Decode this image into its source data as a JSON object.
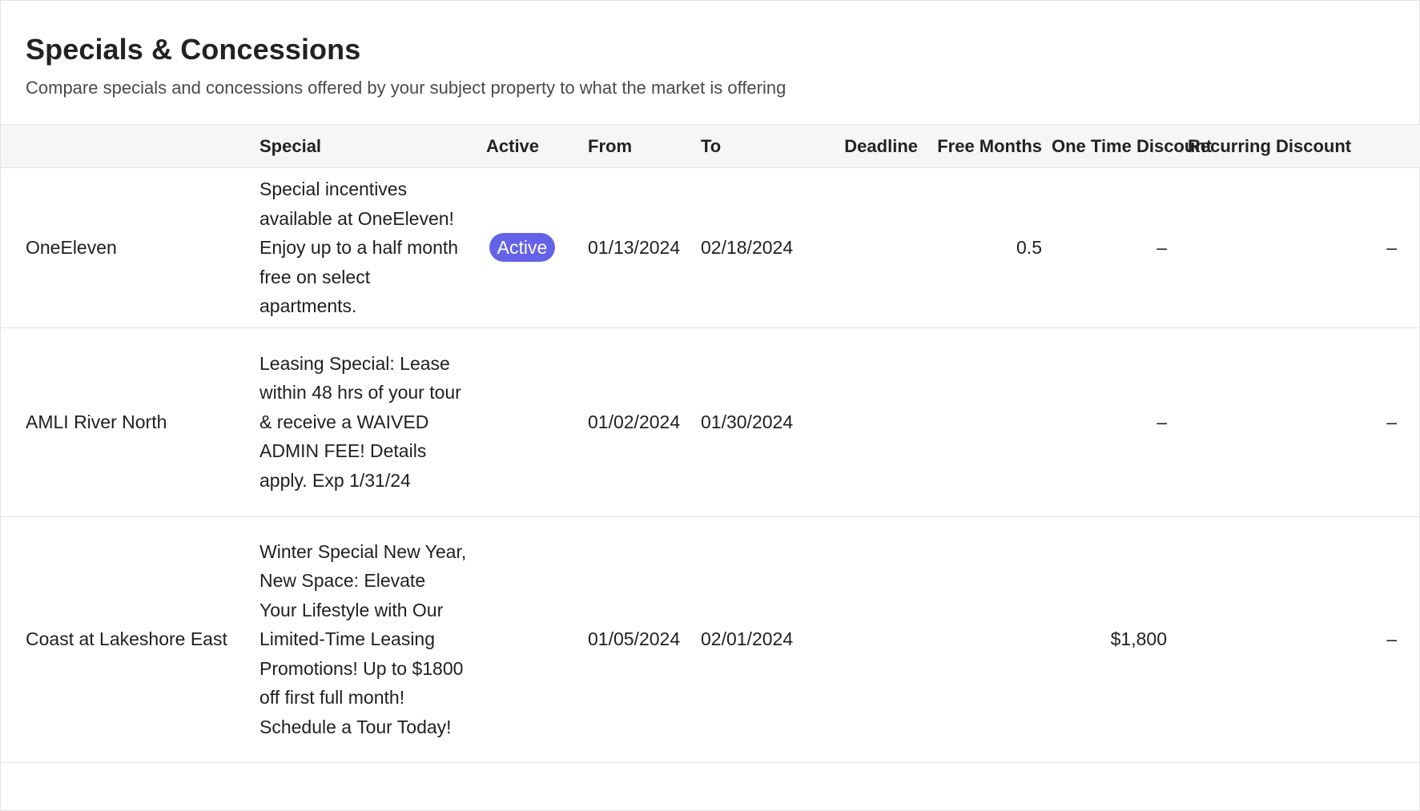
{
  "header": {
    "title": "Specials & Concessions",
    "subtitle": "Compare specials and concessions offered by your subject property to what the market is offering"
  },
  "table": {
    "columns": {
      "property": "",
      "special": "Special",
      "active": "Active",
      "from": "From",
      "to": "To",
      "deadline": "Deadline",
      "free_months": "Free Months",
      "one_time_discount": "One Time Discount",
      "recurring_discount": "Recurring Discount"
    },
    "rows": [
      {
        "property": "OneEleven",
        "special": "Special incentives available at OneEleven! Enjoy up to a half month free on select apartments.",
        "active": "Active",
        "from": "01/13/2024",
        "to": "02/18/2024",
        "deadline": "",
        "free_months": "0.5",
        "one_time_discount": "–",
        "recurring_discount": "–"
      },
      {
        "property": "AMLI River North",
        "special": "Leasing Special: Lease within 48 hrs of your tour & receive a WAIVED ADMIN FEE! Details apply. Exp 1/31/24",
        "active": "",
        "from": "01/02/2024",
        "to": "01/30/2024",
        "deadline": "",
        "free_months": "",
        "one_time_discount": "–",
        "recurring_discount": "–"
      },
      {
        "property": "Coast at Lakeshore East",
        "special": "Winter Special New Year, New Space: Elevate Your Lifestyle with Our Limited-Time Leasing Promotions! Up to $1800 off first full month! Schedule a Tour Today!",
        "active": "",
        "from": "01/05/2024",
        "to": "02/01/2024",
        "deadline": "",
        "free_months": "",
        "one_time_discount": "$1,800",
        "recurring_discount": "–"
      }
    ]
  },
  "colors": {
    "badge_bg": "#6462e8",
    "header_bg": "#f6f6f6",
    "border": "#e3e3e3"
  }
}
